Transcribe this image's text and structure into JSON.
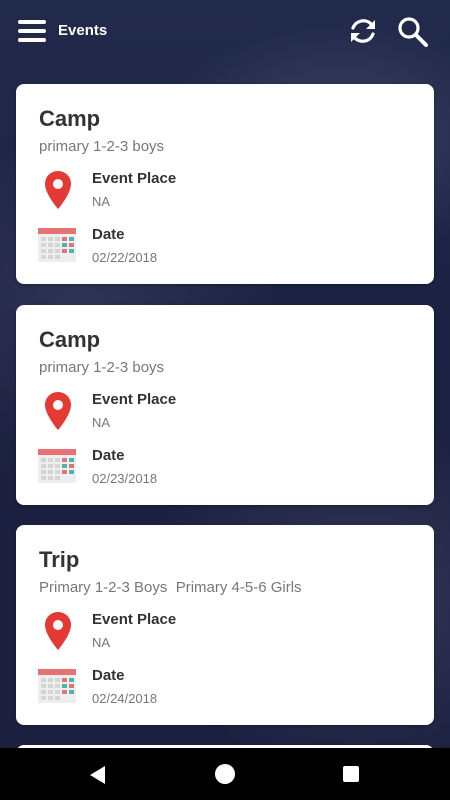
{
  "header": {
    "title": "Events"
  },
  "events": [
    {
      "title": "Camp",
      "group": "primary 1-2-3 boys",
      "place_label": "Event Place",
      "place": "NA",
      "date_label": "Date",
      "date": "02/22/2018"
    },
    {
      "title": "Camp",
      "group": "primary 1-2-3 boys",
      "place_label": "Event Place",
      "place": "NA",
      "date_label": "Date",
      "date": "02/23/2018"
    },
    {
      "title": "Trip",
      "group": "Primary 1-2-3 Boys  Primary 4-5-6 Girls",
      "place_label": "Event Place",
      "place": "NA",
      "date_label": "Date",
      "date": "02/24/2018"
    }
  ],
  "icons": {
    "menu": "menu-icon",
    "refresh": "refresh-icon",
    "search": "search-icon",
    "place": "location-pin-icon",
    "date": "calendar-icon",
    "nav_back": "back-triangle-icon",
    "nav_home": "home-circle-icon",
    "nav_recent": "recent-square-icon"
  },
  "colors": {
    "pin": "#e53935",
    "calendar_header": "#e57373",
    "accent_green": "#4db6ac"
  }
}
